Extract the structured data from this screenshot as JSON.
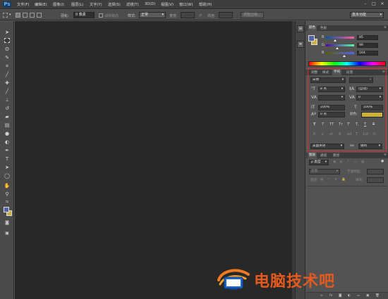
{
  "app": {
    "logo": "Ps"
  },
  "menu": [
    "文件(F)",
    "编辑(E)",
    "图像(I)",
    "图层(L)",
    "文字(Y)",
    "选择(S)",
    "滤镜(T)",
    "3D(D)",
    "视图(V)",
    "窗口(W)",
    "帮助(H)"
  ],
  "window_controls": {
    "minimize": "–",
    "maximize": "□",
    "close": "✕"
  },
  "options_bar": {
    "feather_label": "羽化:",
    "feather_value": "0 像素",
    "antialias_label": "消除锯齿",
    "style_label": "样式:",
    "style_value": "正常",
    "width_label": "宽度:",
    "height_label": "高度:",
    "refine_edge_button": "调整边缘...",
    "workspace_value": "基本功能"
  },
  "color_panel": {
    "tabs": [
      "颜色",
      "色板"
    ],
    "active_tab": 0,
    "channels": [
      {
        "label": "R",
        "value": "85",
        "level": 0.33,
        "gradient": "linear-gradient(90deg,#005aa4,#ff5aa4)"
      },
      {
        "label": "G",
        "value": "99",
        "level": 0.39,
        "gradient": "linear-gradient(90deg,#5500a4,#55ffa4)"
      },
      {
        "label": "B",
        "value": "164",
        "level": 0.64,
        "gradient": "linear-gradient(90deg,#556300,#5563ff)"
      }
    ],
    "foreground_color": "#5563a4",
    "background_color": "#c9b040"
  },
  "character_panel": {
    "tabs": [
      "调整",
      "样式",
      "字符",
      "段落"
    ],
    "active_tab": 2,
    "font_family": "宋体",
    "font_style": "-",
    "font_size": "8 点",
    "leading": "(自动)",
    "kerning": "",
    "tracking": "0",
    "vertical_scale": "100%",
    "horizontal_scale": "100%",
    "baseline_shift": "0 点",
    "color_label": "颜色:",
    "color_swatch": "#c9b040",
    "format_buttons": [
      "T",
      "T",
      "TT",
      "Tт",
      "T'",
      "T,",
      "T",
      "T"
    ],
    "opentype_buttons": [
      "fi",
      "∂",
      "st",
      "A",
      "ad",
      "T",
      "1st",
      "½"
    ],
    "language": "美国英语",
    "antialias_icon": "aa",
    "antialias": "锐利"
  },
  "layers_panel": {
    "tabs": [
      "图层",
      "通道",
      "路径"
    ],
    "active_tab": 0,
    "filter_label": "ρ 类型",
    "blend_mode": "正常",
    "opacity_label": "不透明度:",
    "lock_label": "锁定:",
    "fill_label": "填充:"
  },
  "watermark": {
    "text": "电脑技术吧"
  }
}
